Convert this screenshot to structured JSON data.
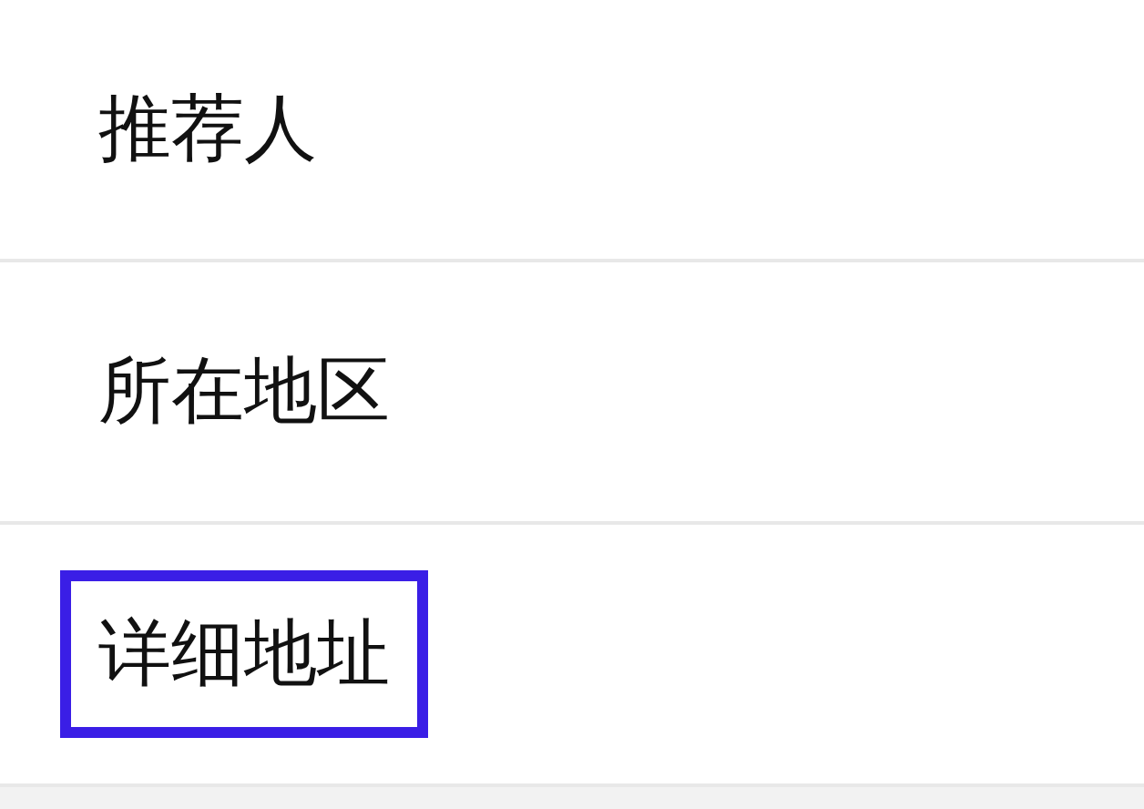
{
  "rows": [
    {
      "label": "推荐人",
      "highlighted": false
    },
    {
      "label": "所在地区",
      "highlighted": false
    },
    {
      "label": "详细地址",
      "highlighted": true
    }
  ]
}
